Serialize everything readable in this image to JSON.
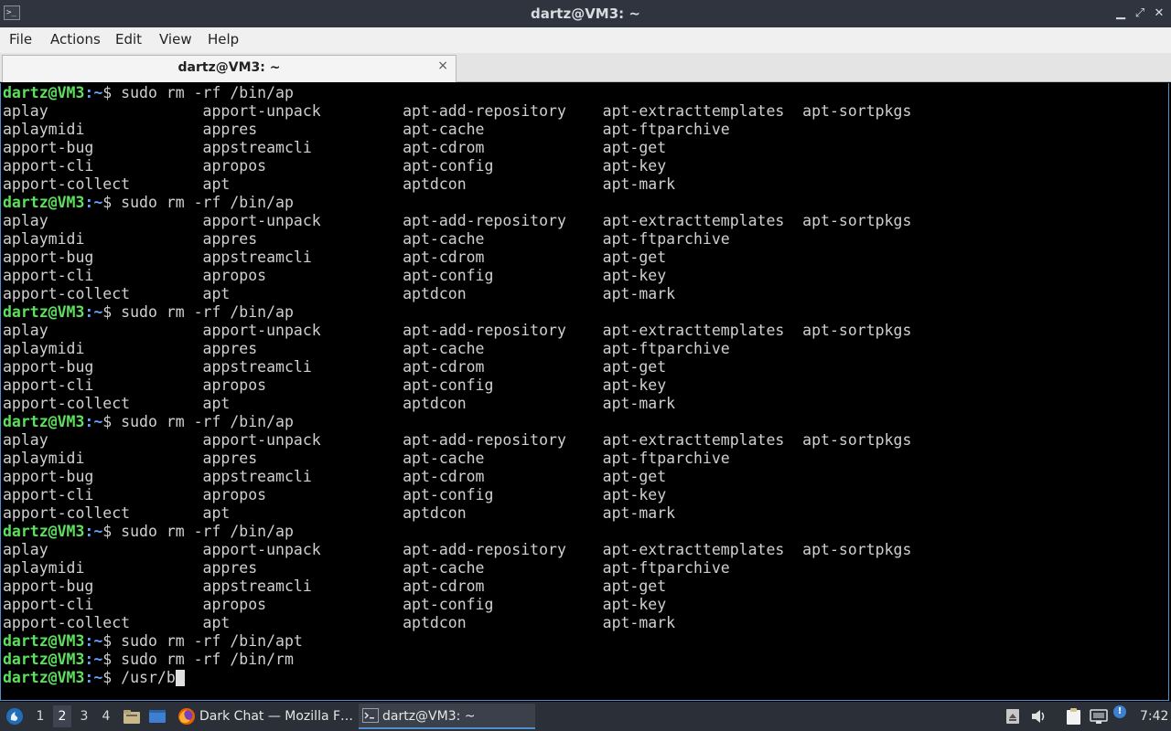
{
  "window": {
    "title": "dartz@VM3: ~"
  },
  "menu": {
    "file": "File",
    "actions": "Actions",
    "edit": "Edit",
    "view": "View",
    "help": "Help"
  },
  "tab": {
    "label": "dartz@VM3: ~",
    "close": "×"
  },
  "terminal": {
    "prompt_user": "dartz@VM3",
    "prompt_path": ":~",
    "prompt_dollar": "$ ",
    "lines": [
      {
        "type": "prompt",
        "cmd": "sudo rm -rf /bin/ap"
      },
      {
        "type": "out",
        "text": "aplay                 apport-unpack         apt-add-repository    apt-extracttemplates  apt-sortpkgs"
      },
      {
        "type": "out",
        "text": "aplaymidi             appres                apt-cache             apt-ftparchive"
      },
      {
        "type": "out",
        "text": "apport-bug            appstreamcli          apt-cdrom             apt-get"
      },
      {
        "type": "out",
        "text": "apport-cli            apropos               apt-config            apt-key"
      },
      {
        "type": "out",
        "text": "apport-collect        apt                   aptdcon               apt-mark"
      },
      {
        "type": "prompt",
        "cmd": "sudo rm -rf /bin/ap"
      },
      {
        "type": "out",
        "text": "aplay                 apport-unpack         apt-add-repository    apt-extracttemplates  apt-sortpkgs"
      },
      {
        "type": "out",
        "text": "aplaymidi             appres                apt-cache             apt-ftparchive"
      },
      {
        "type": "out",
        "text": "apport-bug            appstreamcli          apt-cdrom             apt-get"
      },
      {
        "type": "out",
        "text": "apport-cli            apropos               apt-config            apt-key"
      },
      {
        "type": "out",
        "text": "apport-collect        apt                   aptdcon               apt-mark"
      },
      {
        "type": "prompt",
        "cmd": "sudo rm -rf /bin/ap"
      },
      {
        "type": "out",
        "text": "aplay                 apport-unpack         apt-add-repository    apt-extracttemplates  apt-sortpkgs"
      },
      {
        "type": "out",
        "text": "aplaymidi             appres                apt-cache             apt-ftparchive"
      },
      {
        "type": "out",
        "text": "apport-bug            appstreamcli          apt-cdrom             apt-get"
      },
      {
        "type": "out",
        "text": "apport-cli            apropos               apt-config            apt-key"
      },
      {
        "type": "out",
        "text": "apport-collect        apt                   aptdcon               apt-mark"
      },
      {
        "type": "prompt",
        "cmd": "sudo rm -rf /bin/ap"
      },
      {
        "type": "out",
        "text": "aplay                 apport-unpack         apt-add-repository    apt-extracttemplates  apt-sortpkgs"
      },
      {
        "type": "out",
        "text": "aplaymidi             appres                apt-cache             apt-ftparchive"
      },
      {
        "type": "out",
        "text": "apport-bug            appstreamcli          apt-cdrom             apt-get"
      },
      {
        "type": "out",
        "text": "apport-cli            apropos               apt-config            apt-key"
      },
      {
        "type": "out",
        "text": "apport-collect        apt                   aptdcon               apt-mark"
      },
      {
        "type": "prompt",
        "cmd": "sudo rm -rf /bin/ap"
      },
      {
        "type": "out",
        "text": "aplay                 apport-unpack         apt-add-repository    apt-extracttemplates  apt-sortpkgs"
      },
      {
        "type": "out",
        "text": "aplaymidi             appres                apt-cache             apt-ftparchive"
      },
      {
        "type": "out",
        "text": "apport-bug            appstreamcli          apt-cdrom             apt-get"
      },
      {
        "type": "out",
        "text": "apport-cli            apropos               apt-config            apt-key"
      },
      {
        "type": "out",
        "text": "apport-collect        apt                   aptdcon               apt-mark"
      },
      {
        "type": "prompt",
        "cmd": "sudo rm -rf /bin/apt"
      },
      {
        "type": "prompt",
        "cmd": "sudo rm -rf /bin/rm"
      },
      {
        "type": "prompt",
        "cmd": "/usr/b",
        "cursor": true
      }
    ]
  },
  "taskbar": {
    "workspaces": [
      "1",
      "2",
      "3",
      "4"
    ],
    "active_workspace": "2",
    "tasks": [
      {
        "label": "Dark Chat — Mozilla F…",
        "icon": "firefox-icon"
      },
      {
        "label": "dartz@VM3: ~",
        "icon": "terminal-icon",
        "active": true
      }
    ],
    "clock": "7:42",
    "notification_badge": "!"
  },
  "colors": {
    "prompt_user": "#5de05d",
    "prompt_path": "#6aa0ff",
    "titlebar": "#2f343f",
    "taskbar": "#2b3038",
    "accent": "#4f8fd0"
  }
}
